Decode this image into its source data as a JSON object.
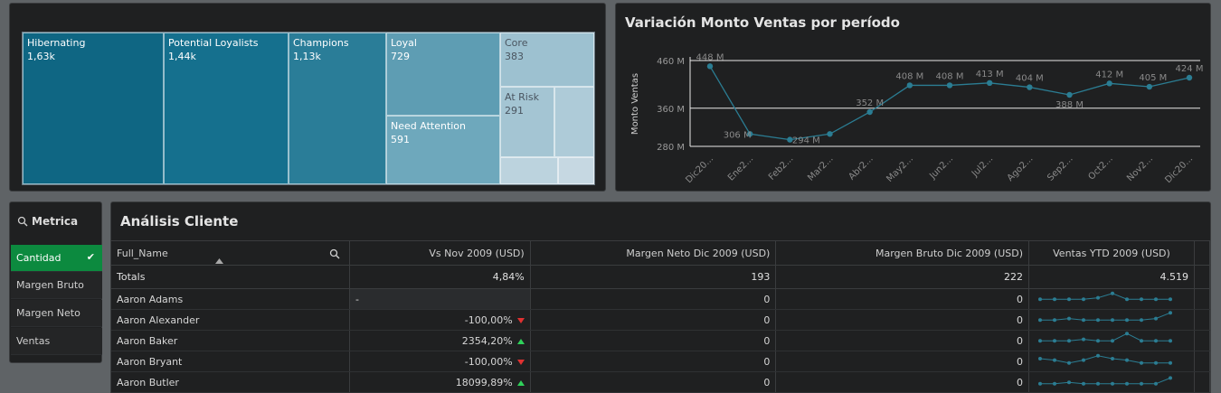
{
  "treemap": {
    "items": [
      {
        "label": "Hibernating",
        "value": "1,63k",
        "color": "#0f6683",
        "light": false
      },
      {
        "label": "Potential Loyalists",
        "value": "1,44k",
        "color": "#15708e",
        "light": false
      },
      {
        "label": "Champions",
        "value": "1,13k",
        "color": "#2a7d98",
        "light": false
      },
      {
        "label": "Loyal",
        "value": "729",
        "color": "#5e9db3",
        "light": false
      },
      {
        "label": "Need Attention",
        "value": "591",
        "color": "#6ea8bc",
        "light": false
      },
      {
        "label": "Core",
        "value": "383",
        "color": "#9dc1d0",
        "light": true
      },
      {
        "label": "At Risk",
        "value": "291",
        "color": "#a4c5d3",
        "light": true
      },
      {
        "label": "",
        "value": "",
        "color": "#aecbd8",
        "light": true
      },
      {
        "label": "",
        "value": "",
        "color": "#bcd3de",
        "light": true
      },
      {
        "label": "",
        "value": "",
        "color": "#c6d8e2",
        "light": true
      }
    ]
  },
  "line_chart": {
    "title": "Variación Monto Ventas por período",
    "chart_data": {
      "type": "line",
      "ylabel": "Monto Ventas",
      "yticks": [
        "280 M",
        "360 M",
        "460 M"
      ],
      "categories": [
        "Dic20...",
        "Ene2...",
        "Feb2...",
        "Mar2...",
        "Abr2...",
        "May2...",
        "Jun2...",
        "Jul2...",
        "Ago2...",
        "Sep2...",
        "Oct2...",
        "Nov2...",
        "Dic20..."
      ],
      "values": [
        448,
        306,
        294,
        306,
        352,
        408,
        408,
        413,
        404,
        388,
        412,
        405,
        424
      ],
      "labels": [
        "448 M",
        "306 M",
        "294 M",
        "",
        "352 M",
        "408 M",
        "408 M",
        "413 M",
        "404 M",
        "388 M",
        "412 M",
        "405 M",
        "424 M"
      ],
      "grid": true
    },
    "line_color": "#2b7d93"
  },
  "metric": {
    "title": "Metrica",
    "items": [
      "Cantidad",
      "Margen Bruto",
      "Margen Neto",
      "Ventas"
    ],
    "selected_check": "✔"
  },
  "table": {
    "title": "Análisis Cliente",
    "columns": [
      "Full_Name",
      "Vs Nov 2009 (USD)",
      "Margen Neto Dic 2009 (USD)",
      "Margen Bruto Dic 2009 (USD)",
      "Ventas YTD 2009 (USD)"
    ],
    "totals": {
      "label": "Totals",
      "vs": "4,84%",
      "neto": "193",
      "bruto": "222",
      "ventas": "4.519"
    },
    "rows": [
      {
        "name": "Aaron Adams",
        "vs": "-",
        "trend": "",
        "neto": "0",
        "bruto": "0",
        "spark": [
          3,
          3,
          3,
          3,
          4,
          7,
          3,
          3,
          3,
          3
        ]
      },
      {
        "name": "Aaron Alexander",
        "vs": "-100,00%",
        "trend": "down",
        "neto": "0",
        "bruto": "0",
        "spark": [
          3,
          3,
          4,
          3,
          3,
          3,
          3,
          3,
          4,
          8
        ]
      },
      {
        "name": "Aaron Baker",
        "vs": "2354,20%",
        "trend": "up",
        "neto": "0",
        "bruto": "0",
        "spark": [
          3,
          3,
          3,
          4,
          3,
          3,
          8,
          3,
          3,
          3
        ]
      },
      {
        "name": "Aaron Bryant",
        "vs": "-100,00%",
        "trend": "down",
        "neto": "0",
        "bruto": "0",
        "spark": [
          5,
          4,
          2,
          4,
          7,
          5,
          4,
          2,
          2,
          2
        ]
      },
      {
        "name": "Aaron Butler",
        "vs": "18099,89%",
        "trend": "up",
        "neto": "0",
        "bruto": "0",
        "spark": [
          2,
          2,
          3,
          2,
          2,
          2,
          2,
          2,
          2,
          6
        ]
      }
    ],
    "spark_color": "#2b7d93"
  }
}
